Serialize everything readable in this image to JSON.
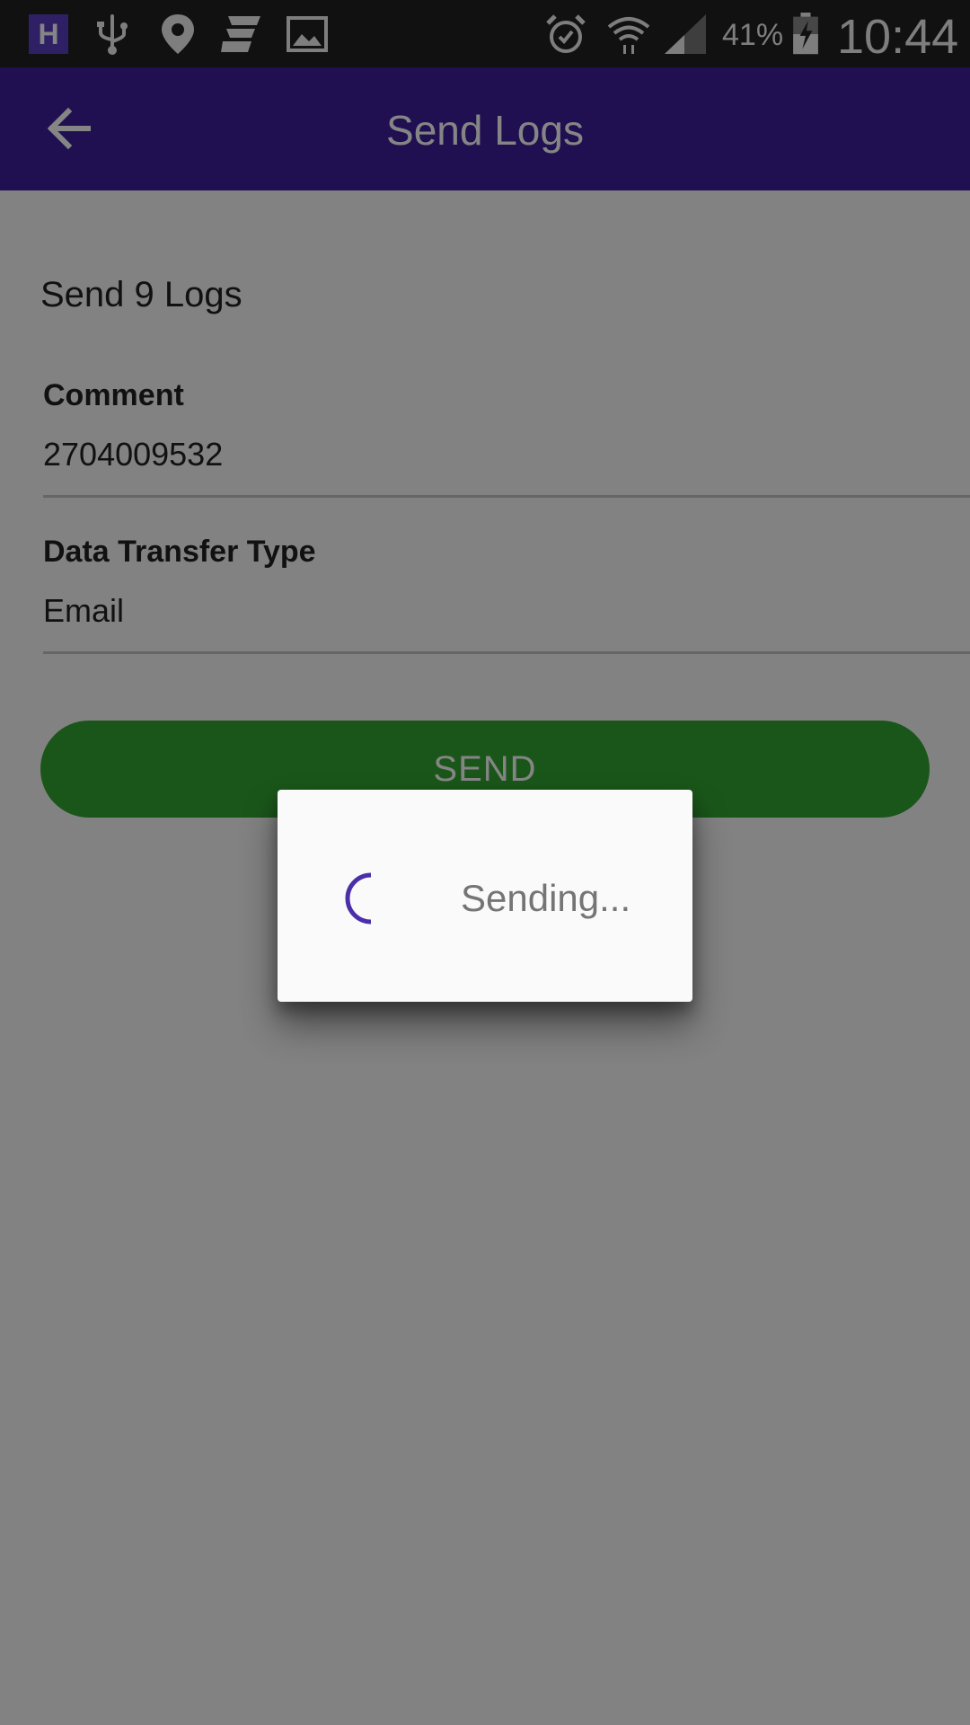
{
  "status_bar": {
    "app_icon_letter": "H",
    "battery_percent": "41%",
    "time": "10:44",
    "icons": [
      "app-h-icon",
      "usb-icon",
      "location-pin-icon",
      "news-icon",
      "image-icon",
      "alarm-icon",
      "wifi-icon",
      "signal-icon",
      "battery-charging-icon"
    ]
  },
  "app_bar": {
    "title": "Send Logs",
    "back_icon": "arrow-back-icon"
  },
  "form": {
    "heading": "Send 9 Logs",
    "comment_label": "Comment",
    "comment_value": "2704009532",
    "transfer_label": "Data Transfer Type",
    "transfer_value": "Email",
    "send_button": "SEND"
  },
  "dialog": {
    "message": "Sending..."
  },
  "colors": {
    "status_bar": "#222222",
    "app_bar": "#3e209e",
    "send_button": "#33a532",
    "spinner": "#4a2fa8",
    "scrim": "rgba(0,0,0,0.48)"
  }
}
